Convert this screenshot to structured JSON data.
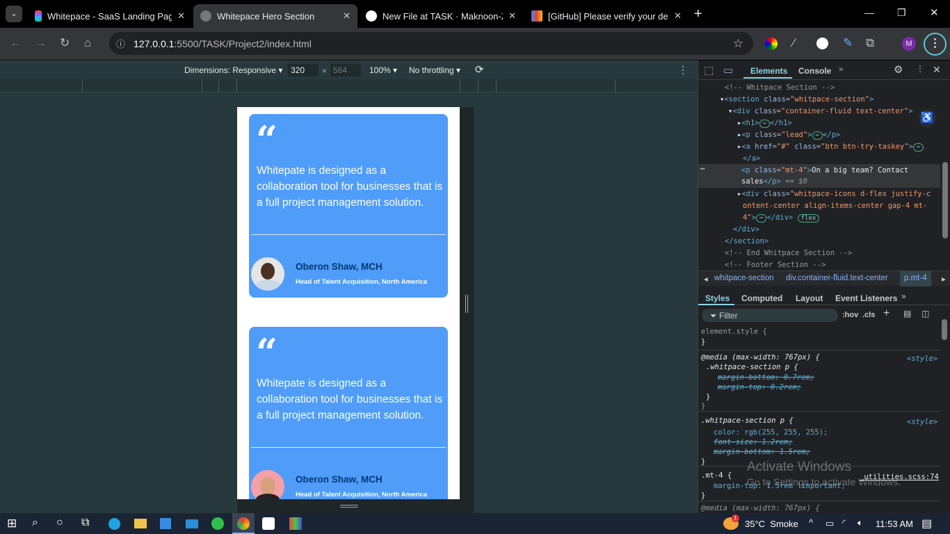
{
  "browser": {
    "tabs": [
      {
        "title": "Whitepace - SaaS Landing Page",
        "active": false
      },
      {
        "title": "Whitepace Hero Section",
        "active": true
      },
      {
        "title": "New File at TASK · Maknoon-Zia",
        "active": false
      },
      {
        "title": "[GitHub] Please verify your device",
        "active": false
      }
    ],
    "url_host": "127.0.0.1",
    "url_rest": ":5500/TASK/Project2/index.html",
    "profile_initial": "M"
  },
  "device_toolbar": {
    "dimensions_label": "Dimensions: Responsive",
    "width": "320",
    "height": "564",
    "zoom": "100%",
    "throttling": "No throttling"
  },
  "page": {
    "testimonials": [
      {
        "quote_mark": "“",
        "text": "Whitepate is designed as a collaboration tool for businesses that is a full project management solution.",
        "name": "Oberon Shaw, MCH",
        "role": "Head of Talent Acquisition, North America"
      },
      {
        "quote_mark": "“",
        "text": "Whitepate is designed as a collaboration tool for businesses that is a full project management solution.",
        "name": "Oberon Shaw, MCH",
        "role": "Head of Talent Acquisition, North America"
      }
    ],
    "card_color": "#4f9cf9",
    "name_color": "#043873"
  },
  "devtools": {
    "tabs": [
      "Elements",
      "Console"
    ],
    "breadcrumbs": [
      "whitpace-section",
      "div.container-fluid.text-center",
      "p.mt-4"
    ],
    "style_tabs": [
      "Styles",
      "Computed",
      "Layout",
      "Event Listeners"
    ],
    "filter_placeholder": "Filter",
    "hov": ":hov",
    "cls": ".cls",
    "styles": {
      "element_style": "element.style {",
      "media1": "@media (max-width: 767px) {",
      "rule1_sel": ".whitpace-section p {",
      "rule1_props": [
        "margin-bottom: 0.7rem;",
        "margin-top: 0.2rem;"
      ],
      "rule2_sel": ".whitpace-section p {",
      "rule2_color": "color: rgb(255, 255, 255);",
      "rule2_props": [
        "font-size: 1.2rem;",
        "margin-bottom: 1.5rem;"
      ],
      "rule3_sel": ".mt-4 {",
      "rule3_prop": "margin-top: 1.5rem !important;",
      "rule3_source": "_utilities.scss:74",
      "style_source": "<style>",
      "media2": "@media (max-width: 767px) {"
    }
  },
  "watermark": {
    "title": "Activate Windows",
    "subtitle": "Go to Settings to activate Windows."
  },
  "taskbar": {
    "weather": "35°C  Smoke",
    "badge": "1",
    "time": "11:53 AM"
  }
}
